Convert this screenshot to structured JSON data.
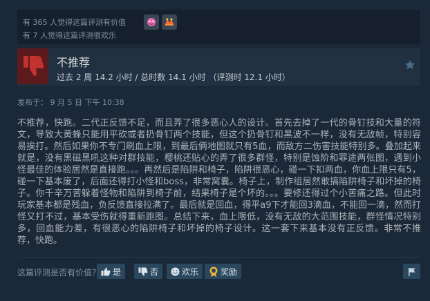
{
  "helpful": {
    "helpful_text": "有 365 人觉得这篇评测有价值",
    "funny_text": "有 7 人觉得这篇评测很欢乐"
  },
  "awards": [
    "heart-eyes-award-icon",
    "jester-award-icon"
  ],
  "header": {
    "verdict": "不推荐",
    "hours": "过去 2 周 14.2 小时 / 总时数 14.1 小时 （评测时 12.1 小时）",
    "thumb_icon": "thumbs-down-icon"
  },
  "posted": "发布于：  9 月 5 日 下午 10:38",
  "review": "不推荐，快跑。二代正反馈不足，而且弄了很多恶心人的设计。首先去掉了一代的骨钉技和大量的符文，导致大黄蜂只能用平砍或者扔骨钉两个技能，但这个扔骨钉和黑波不一样，没有无敌帧，特别容易挨打。然后如果你不专门刷血上限，到最后俩地图就只有5血，而敌方二伤害技能特别多。叠加起来就是，没有黑磁黑吼这种对群技能，樱桃还贴心的弄了很多群怪，特别是蚀阶和罪途两张图，遇到小怪最佳的体验居然是直接跑。。。再然后是陷阱和椅子，陷阱很恶心，碰一下扣两血，你血上限只有5，碰一下基本废了，后面还得打小怪和boss，非常窝囊。椅子上，制作组居然敢搞陷阱椅子和坏掉的椅子。你千辛万苦躲着怪物和陷阱到椅子前，结果椅子是个坏的。。。要修还得过个小苦痛之路。但此时玩家基本都是残血，负反馈直接拉满了。最后就是回血，得平a9下才能回3滴血，不能回一滴，然而打怪又打不过，基本受伤就得重新跑图。总结下来，血上限低，没有无敌的大范围技能，群怪情况特别多，回血能力差，有很恶心的陷阱椅子和坏掉的椅子设计。这一套下来基本没有正反馈。非常不推荐，快跑。",
  "vote": {
    "question": "这篇评测是否有价值？",
    "yes": "是",
    "no": "否",
    "funny": "欢乐",
    "award": "奖励"
  }
}
